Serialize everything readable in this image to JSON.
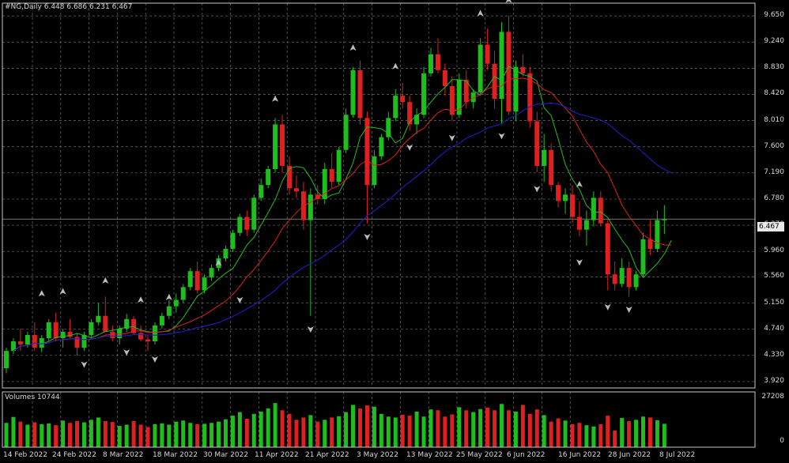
{
  "window": {
    "symbol_title": "#NG,Daily  6.448 6.686 6.231 6.467",
    "volumes_title": "Volumes 10744"
  },
  "price_axis": {
    "ticks": [
      "9.650",
      "9.240",
      "8.830",
      "8.420",
      "8.010",
      "7.600",
      "7.190",
      "6.780",
      "6.370",
      "5.960",
      "5.560",
      "5.150",
      "4.740",
      "4.330",
      "3.920"
    ],
    "current_price": "6.467"
  },
  "volume_axis": {
    "max_label": "27208",
    "min_label": "0"
  },
  "date_axis": {
    "ticks": [
      "14 Feb 2022",
      "24 Feb 2022",
      "8 Mar 2022",
      "18 Mar 2022",
      "30 Mar 2022",
      "11 Apr 2022",
      "21 Apr 2022",
      "3 May 2022",
      "13 May 2022",
      "25 May 2022",
      "6 Jun 2022",
      "16 Jun 2022",
      "28 Jun 2022",
      "8 Jul 2022"
    ]
  },
  "colors": {
    "background": "#000000",
    "grid": "#6e6e6e",
    "bull": "#1fbe1f",
    "bear": "#e02020",
    "ma_fast": "#1fbe1f",
    "ma_mid": "#e02020",
    "ma_slow": "#2020d0",
    "axis_text": "#d8d8d8",
    "fractal": "#bcbcbc"
  },
  "chart_data": {
    "type": "candlestick",
    "symbol": "#NG",
    "timeframe": "Daily",
    "last_bar": {
      "open": 6.448,
      "high": 6.686,
      "low": 6.231,
      "close": 6.467
    },
    "y_range": [
      3.82,
      9.85
    ],
    "volume_range": [
      0,
      27208
    ],
    "ohlc": [
      [
        4.13,
        4.45,
        4.05,
        4.4
      ],
      [
        4.4,
        4.6,
        4.35,
        4.55
      ],
      [
        4.55,
        4.75,
        4.4,
        4.5
      ],
      [
        4.5,
        4.7,
        4.45,
        4.65
      ],
      [
        4.65,
        4.85,
        4.4,
        4.45
      ],
      [
        4.45,
        4.65,
        4.38,
        4.6
      ],
      [
        4.6,
        4.9,
        4.55,
        4.85
      ],
      [
        4.85,
        5.0,
        4.55,
        4.6
      ],
      [
        4.6,
        4.75,
        4.45,
        4.7
      ],
      [
        4.7,
        4.9,
        4.6,
        4.62
      ],
      [
        4.62,
        4.68,
        4.32,
        4.45
      ],
      [
        4.45,
        4.7,
        4.4,
        4.65
      ],
      [
        4.65,
        4.9,
        4.6,
        4.85
      ],
      [
        4.85,
        5.15,
        4.8,
        4.95
      ],
      [
        4.95,
        5.25,
        4.85,
        4.7
      ],
      [
        4.7,
        4.8,
        4.55,
        4.6
      ],
      [
        4.6,
        4.8,
        4.5,
        4.75
      ],
      [
        4.75,
        4.98,
        4.7,
        4.9
      ],
      [
        4.9,
        4.95,
        4.65,
        4.68
      ],
      [
        4.68,
        4.8,
        4.55,
        4.58
      ],
      [
        4.58,
        4.65,
        4.4,
        4.55
      ],
      [
        4.55,
        4.85,
        4.5,
        4.8
      ],
      [
        4.8,
        5.0,
        4.75,
        4.95
      ],
      [
        4.95,
        5.2,
        4.9,
        5.1
      ],
      [
        5.1,
        5.3,
        5.0,
        5.2
      ],
      [
        5.2,
        5.45,
        5.15,
        5.4
      ],
      [
        5.4,
        5.7,
        5.35,
        5.65
      ],
      [
        5.65,
        5.8,
        5.3,
        5.35
      ],
      [
        5.35,
        5.6,
        5.3,
        5.55
      ],
      [
        5.55,
        5.75,
        5.5,
        5.7
      ],
      [
        5.7,
        5.9,
        5.65,
        5.85
      ],
      [
        5.85,
        6.05,
        5.8,
        6.0
      ],
      [
        6.0,
        6.3,
        5.95,
        6.25
      ],
      [
        6.25,
        6.55,
        6.2,
        6.5
      ],
      [
        6.5,
        6.6,
        6.2,
        6.3
      ],
      [
        6.3,
        6.85,
        6.25,
        6.8
      ],
      [
        6.8,
        7.1,
        6.75,
        7.0
      ],
      [
        7.0,
        7.3,
        6.95,
        7.25
      ],
      [
        7.25,
        8.05,
        7.2,
        7.95
      ],
      [
        7.95,
        8.1,
        7.2,
        7.3
      ],
      [
        7.3,
        7.45,
        6.85,
        6.95
      ],
      [
        6.95,
        7.15,
        6.8,
        6.9
      ],
      [
        6.9,
        7.05,
        6.3,
        6.45
      ],
      [
        6.45,
        6.95,
        4.95,
        6.85
      ],
      [
        6.85,
        7.0,
        6.7,
        6.78
      ],
      [
        6.78,
        7.35,
        6.7,
        7.25
      ],
      [
        7.25,
        7.5,
        6.95,
        7.05
      ],
      [
        7.05,
        7.6,
        7.0,
        7.55
      ],
      [
        7.55,
        8.2,
        7.5,
        8.1
      ],
      [
        8.1,
        8.85,
        8.05,
        8.8
      ],
      [
        8.8,
        8.95,
        7.95,
        8.05
      ],
      [
        8.05,
        8.15,
        6.4,
        7.0
      ],
      [
        7.0,
        7.55,
        6.95,
        7.45
      ],
      [
        7.45,
        7.8,
        7.4,
        7.75
      ],
      [
        7.75,
        8.15,
        7.7,
        8.05
      ],
      [
        8.05,
        8.5,
        8.0,
        8.4
      ],
      [
        8.4,
        8.6,
        8.2,
        8.3
      ],
      [
        8.3,
        8.4,
        7.85,
        7.95
      ],
      [
        7.95,
        8.2,
        7.8,
        8.1
      ],
      [
        8.1,
        8.85,
        8.05,
        8.75
      ],
      [
        8.75,
        9.15,
        8.7,
        9.05
      ],
      [
        9.05,
        9.3,
        8.75,
        8.8
      ],
      [
        8.8,
        8.9,
        8.4,
        8.55
      ],
      [
        8.55,
        8.7,
        8.0,
        8.1
      ],
      [
        8.1,
        8.75,
        8.05,
        8.65
      ],
      [
        8.65,
        8.8,
        8.2,
        8.3
      ],
      [
        8.3,
        8.5,
        8.2,
        8.45
      ],
      [
        8.45,
        9.3,
        8.4,
        9.2
      ],
      [
        9.2,
        9.45,
        8.8,
        8.9
      ],
      [
        8.9,
        9.1,
        8.2,
        8.35
      ],
      [
        8.35,
        9.55,
        7.95,
        9.4
      ],
      [
        9.4,
        9.65,
        8.1,
        8.15
      ],
      [
        8.15,
        8.95,
        8.0,
        8.85
      ],
      [
        8.85,
        9.05,
        8.7,
        8.75
      ],
      [
        8.75,
        8.85,
        7.9,
        8.0
      ],
      [
        8.0,
        8.15,
        7.2,
        7.3
      ],
      [
        7.3,
        7.8,
        7.05,
        7.55
      ],
      [
        7.55,
        7.65,
        6.9,
        7.0
      ],
      [
        7.0,
        7.05,
        6.65,
        6.75
      ],
      [
        6.75,
        6.95,
        6.55,
        6.85
      ],
      [
        6.85,
        7.0,
        6.4,
        6.5
      ],
      [
        6.5,
        6.75,
        6.2,
        6.3
      ],
      [
        6.3,
        6.6,
        6.05,
        6.45
      ],
      [
        6.45,
        6.9,
        6.35,
        6.8
      ],
      [
        6.8,
        6.9,
        6.35,
        6.4
      ],
      [
        6.4,
        6.45,
        5.35,
        5.6
      ],
      [
        5.6,
        5.8,
        5.35,
        5.45
      ],
      [
        5.45,
        5.85,
        5.4,
        5.7
      ],
      [
        5.7,
        5.8,
        5.25,
        5.4
      ],
      [
        5.4,
        5.65,
        5.35,
        5.6
      ],
      [
        5.6,
        6.25,
        5.55,
        6.15
      ],
      [
        6.15,
        6.45,
        5.9,
        6.0
      ],
      [
        6.0,
        6.6,
        5.95,
        6.45
      ],
      [
        6.448,
        6.686,
        6.231,
        6.467
      ]
    ],
    "volumes": [
      13500,
      16800,
      14200,
      12500,
      13800,
      12800,
      13200,
      12200,
      14800,
      13500,
      14500,
      13800,
      15200,
      16500,
      14500,
      14000,
      11800,
      12500,
      14500,
      12500,
      11200,
      12800,
      13200,
      12500,
      14200,
      14800,
      13500,
      12800,
      13000,
      13500,
      14200,
      15500,
      17500,
      19500,
      15800,
      18500,
      19800,
      21500,
      24500,
      20500,
      18500,
      15200,
      16500,
      17800,
      14200,
      15200,
      16500,
      17200,
      19500,
      23500,
      21500,
      23200,
      22500,
      18500,
      17000,
      16500,
      18000,
      17500,
      19800,
      17000,
      21000,
      20500,
      17000,
      18200,
      22200,
      20500,
      19500,
      21200,
      22000,
      20500,
      24000,
      20500,
      19800,
      23500,
      18500,
      21000,
      17800,
      14200,
      16000,
      14800,
      12800,
      13500,
      12200,
      11500,
      12800,
      17500,
      9200,
      16200,
      14500,
      15200,
      17000,
      16500,
      15000,
      13000
    ],
    "fractals_up": [
      {
        "i": 5,
        "price": 5.28
      },
      {
        "i": 8,
        "price": 5.31
      },
      {
        "i": 14,
        "price": 5.48
      },
      {
        "i": 19,
        "price": 5.18
      },
      {
        "i": 23,
        "price": 5.22
      },
      {
        "i": 30,
        "price": 5.76
      },
      {
        "i": 38,
        "price": 8.33
      },
      {
        "i": 49,
        "price": 9.13
      },
      {
        "i": 55,
        "price": 8.84
      },
      {
        "i": 67,
        "price": 9.67
      },
      {
        "i": 71,
        "price": 9.88
      },
      {
        "i": 81,
        "price": 6.99
      }
    ],
    "fractals_down": [
      {
        "i": 11,
        "price": 4.21
      },
      {
        "i": 17,
        "price": 4.4
      },
      {
        "i": 21,
        "price": 4.29
      },
      {
        "i": 33,
        "price": 5.22
      },
      {
        "i": 43,
        "price": 4.76
      },
      {
        "i": 51,
        "price": 6.21
      },
      {
        "i": 57,
        "price": 7.61
      },
      {
        "i": 63,
        "price": 7.76
      },
      {
        "i": 70,
        "price": 7.79
      },
      {
        "i": 75,
        "price": 6.96
      },
      {
        "i": 81,
        "price": 5.81
      },
      {
        "i": 85,
        "price": 5.11
      },
      {
        "i": 88,
        "price": 5.07
      }
    ],
    "indicators": [
      {
        "type": "SMA",
        "period": 5,
        "color": "#1fbe1f"
      },
      {
        "type": "SMA",
        "period": 13,
        "color": "#e02020"
      },
      {
        "type": "SMA",
        "period": 30,
        "color": "#2020d0"
      }
    ],
    "grid": true
  }
}
